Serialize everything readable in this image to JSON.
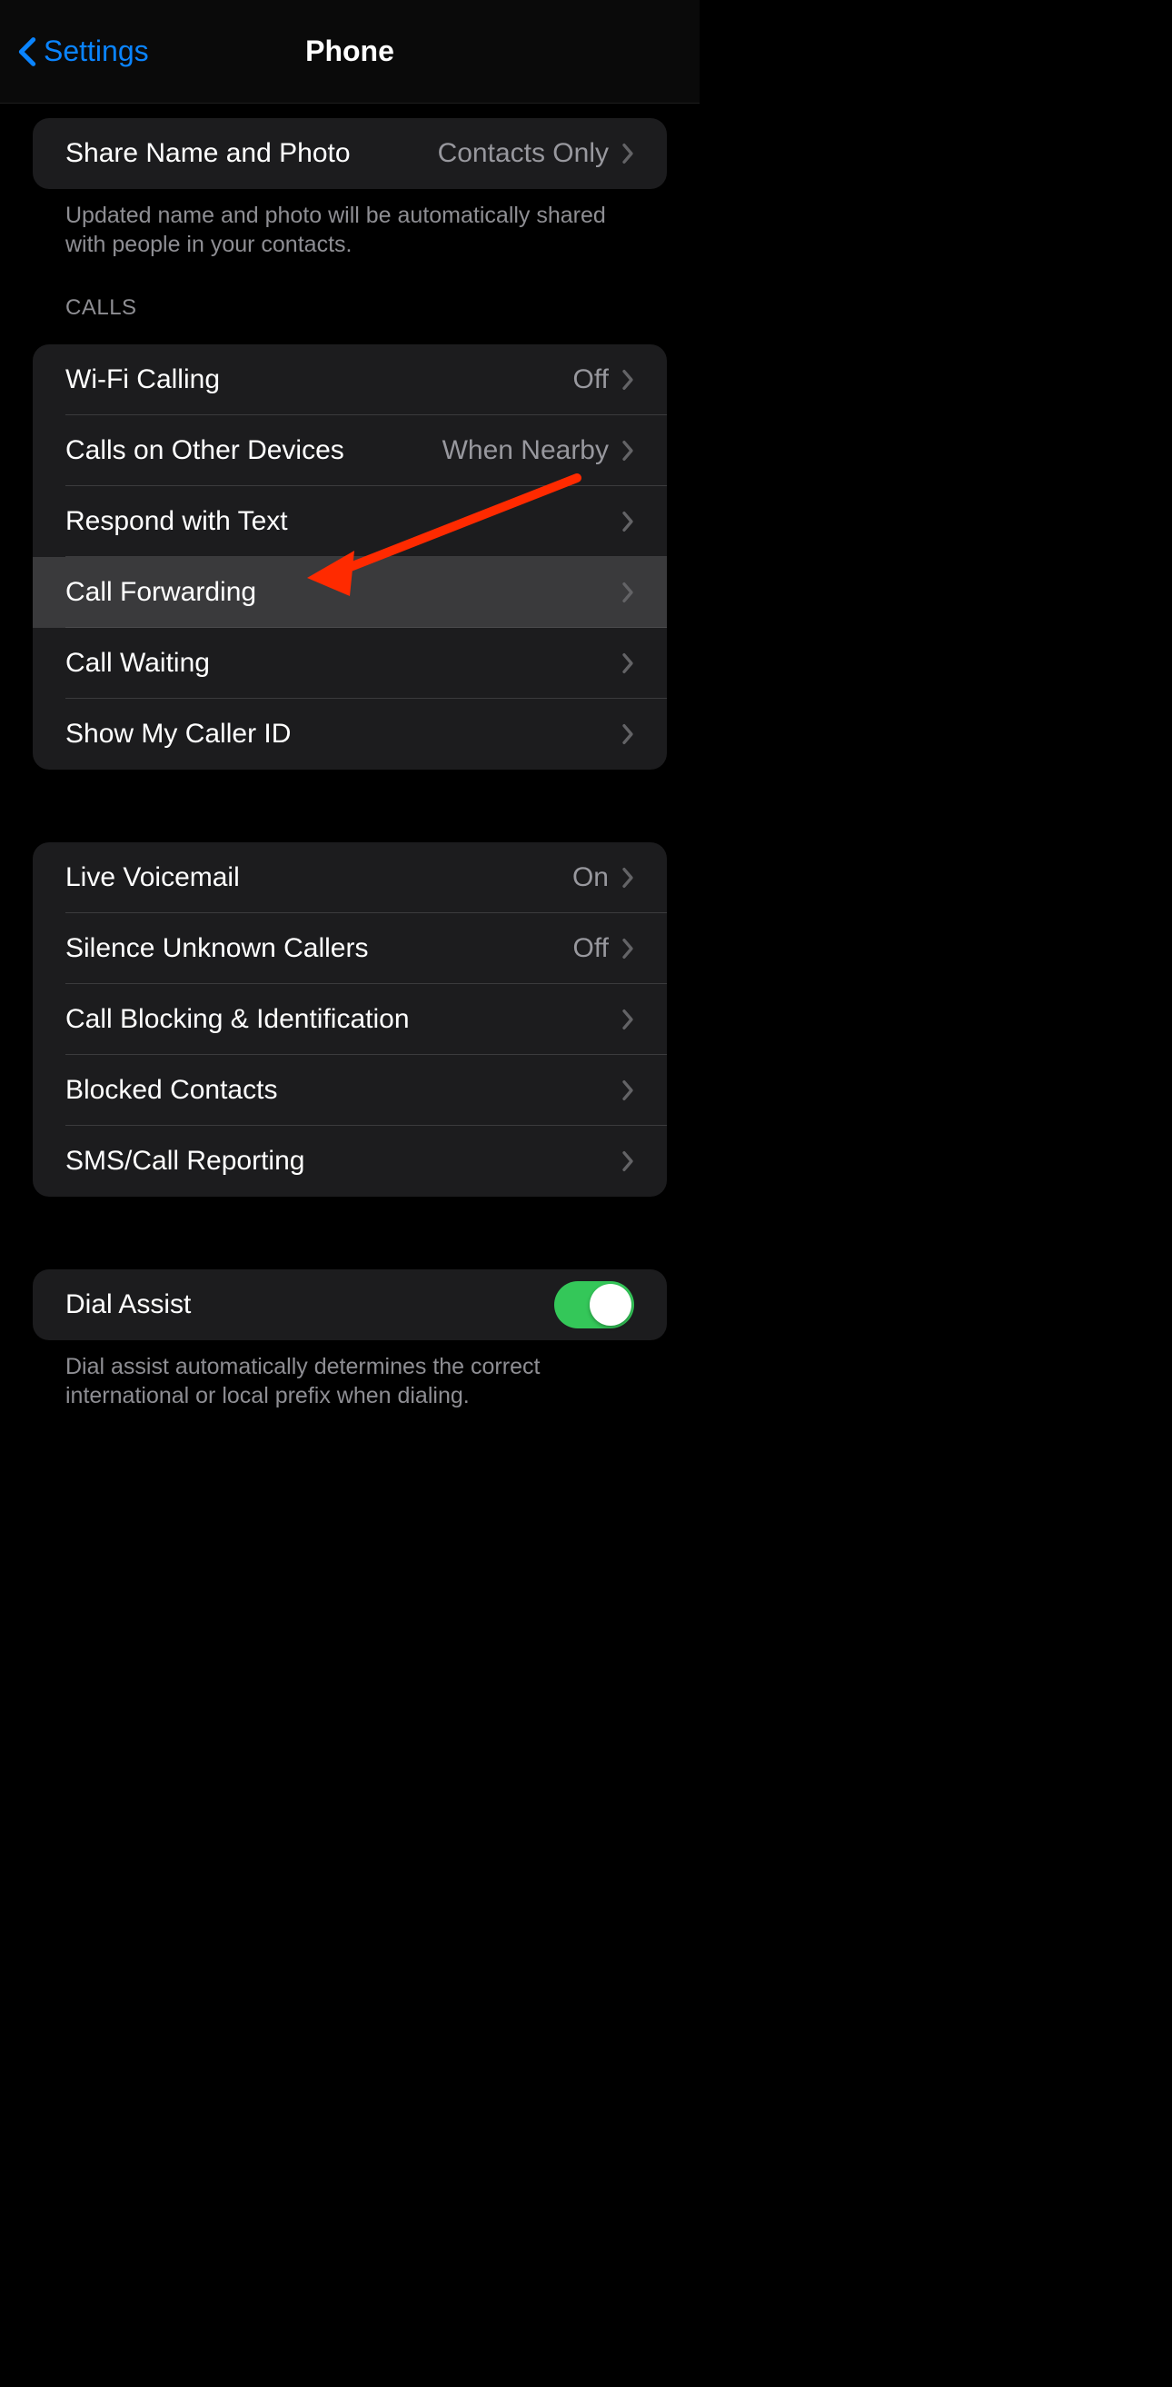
{
  "nav": {
    "back_label": "Settings",
    "title": "Phone"
  },
  "group_share": {
    "items": [
      {
        "label": "Share Name and Photo",
        "value": "Contacts Only"
      }
    ],
    "footer": "Updated name and photo will be automatically shared with people in your contacts."
  },
  "calls_header": "CALLS",
  "group_calls": {
    "items": [
      {
        "label": "Wi-Fi Calling",
        "value": "Off"
      },
      {
        "label": "Calls on Other Devices",
        "value": "When Nearby"
      },
      {
        "label": "Respond with Text",
        "value": ""
      },
      {
        "label": "Call Forwarding",
        "value": ""
      },
      {
        "label": "Call Waiting",
        "value": ""
      },
      {
        "label": "Show My Caller ID",
        "value": ""
      }
    ]
  },
  "group_voice": {
    "items": [
      {
        "label": "Live Voicemail",
        "value": "On"
      },
      {
        "label": "Silence Unknown Callers",
        "value": "Off"
      },
      {
        "label": "Call Blocking & Identification",
        "value": ""
      },
      {
        "label": "Blocked Contacts",
        "value": ""
      },
      {
        "label": "SMS/Call Reporting",
        "value": ""
      }
    ]
  },
  "group_dial": {
    "items": [
      {
        "label": "Dial Assist",
        "toggle": true
      }
    ],
    "footer": "Dial assist automatically determines the correct international or local prefix when dialing."
  }
}
